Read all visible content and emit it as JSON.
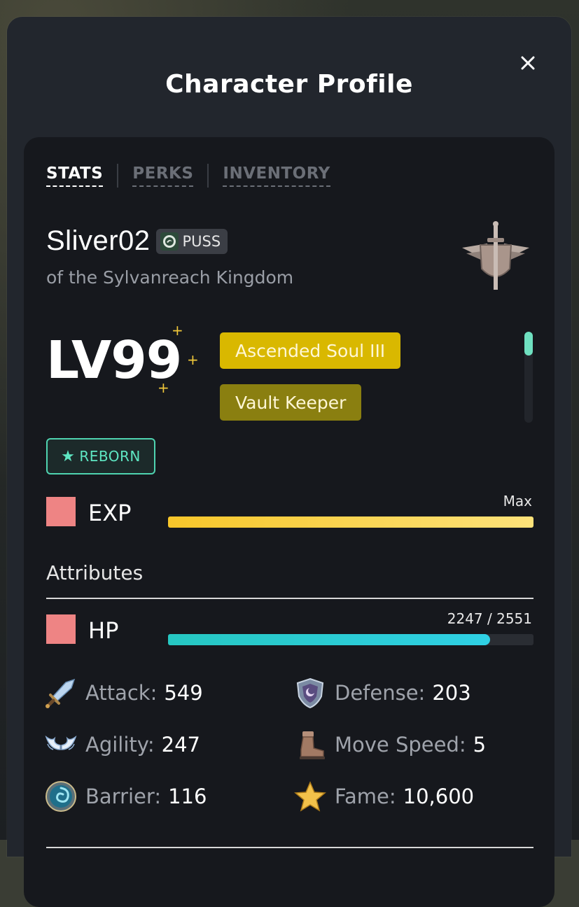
{
  "modal": {
    "title": "Character Profile",
    "close_icon": "close-icon"
  },
  "tabs": [
    {
      "label": "STATS",
      "active": true
    },
    {
      "label": "PERKS",
      "active": false
    },
    {
      "label": "INVENTORY",
      "active": false
    }
  ],
  "character": {
    "name": "Sliver02",
    "guild_tag": "PUSS",
    "kingdom": "of the Sylvanreach Kingdom",
    "level": "LV99",
    "titles": [
      "Ascended Soul III",
      "Vault Keeper"
    ],
    "reborn_label": "REBORN"
  },
  "exp": {
    "label": "EXP",
    "value_text": "Max",
    "fill_fraction": 1.0
  },
  "attributes": {
    "section_title": "Attributes",
    "hp": {
      "label": "HP",
      "value_text": "2247 / 2551",
      "current": 2247,
      "max": 2551
    },
    "stats": [
      {
        "label": "Attack:",
        "value": "549",
        "icon": "sword-icon"
      },
      {
        "label": "Defense:",
        "value": "203",
        "icon": "shield-icon"
      },
      {
        "label": "Agility:",
        "value": "247",
        "icon": "wings-icon"
      },
      {
        "label": "Move Speed:",
        "value": "5",
        "icon": "boot-icon"
      },
      {
        "label": "Barrier:",
        "value": "116",
        "icon": "vortex-orb-icon"
      },
      {
        "label": "Fame:",
        "value": "10,600",
        "icon": "star-icon"
      }
    ]
  },
  "colors": {
    "exp_bar": "#f7c62a",
    "hp_bar": "#2fd0d8",
    "title_primary": "#d9b800",
    "title_secondary": "#8a7f10",
    "reborn": "#4fd3b0",
    "stat_box": "#ee8484"
  }
}
